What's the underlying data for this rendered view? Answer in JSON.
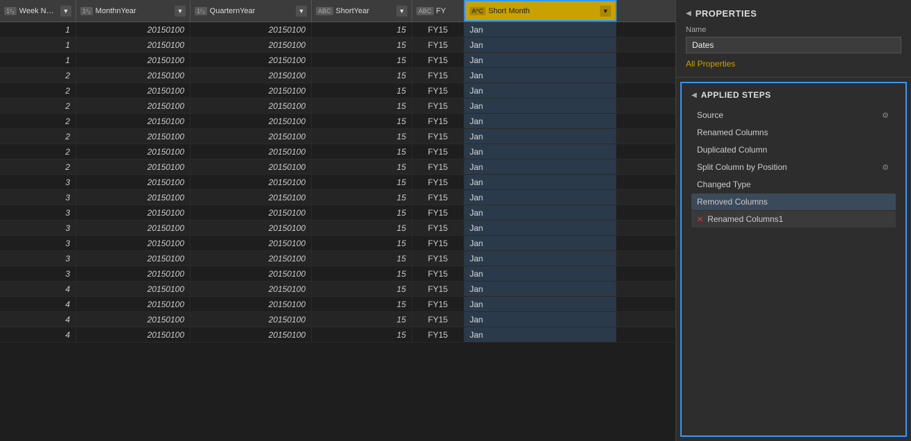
{
  "columns": [
    {
      "id": "week-number",
      "label": "Week Number",
      "type": "123",
      "typeLabel": "123"
    },
    {
      "id": "month-year",
      "label": "MonthnYear",
      "type": "123",
      "typeLabel": "1²₃"
    },
    {
      "id": "quarter-year",
      "label": "QuarternYear",
      "type": "123",
      "typeLabel": "1²₃"
    },
    {
      "id": "short-year",
      "label": "ShortYear",
      "type": "ABC",
      "typeLabel": "ABC"
    },
    {
      "id": "fy",
      "label": "FY",
      "type": "ABC",
      "typeLabel": "ABC"
    },
    {
      "id": "short-month",
      "label": "Short Month",
      "type": "ABC",
      "typeLabel": "A^C"
    }
  ],
  "rows": [
    {
      "weekNum": 1,
      "monthYear": "20150100",
      "quarterYear": "20150100",
      "shortYear": "15",
      "fy": "FY15",
      "shortMonth": "Jan"
    },
    {
      "weekNum": 1,
      "monthYear": "20150100",
      "quarterYear": "20150100",
      "shortYear": "15",
      "fy": "FY15",
      "shortMonth": "Jan"
    },
    {
      "weekNum": 1,
      "monthYear": "20150100",
      "quarterYear": "20150100",
      "shortYear": "15",
      "fy": "FY15",
      "shortMonth": "Jan"
    },
    {
      "weekNum": 2,
      "monthYear": "20150100",
      "quarterYear": "20150100",
      "shortYear": "15",
      "fy": "FY15",
      "shortMonth": "Jan"
    },
    {
      "weekNum": 2,
      "monthYear": "20150100",
      "quarterYear": "20150100",
      "shortYear": "15",
      "fy": "FY15",
      "shortMonth": "Jan"
    },
    {
      "weekNum": 2,
      "monthYear": "20150100",
      "quarterYear": "20150100",
      "shortYear": "15",
      "fy": "FY15",
      "shortMonth": "Jan"
    },
    {
      "weekNum": 2,
      "monthYear": "20150100",
      "quarterYear": "20150100",
      "shortYear": "15",
      "fy": "FY15",
      "shortMonth": "Jan"
    },
    {
      "weekNum": 2,
      "monthYear": "20150100",
      "quarterYear": "20150100",
      "shortYear": "15",
      "fy": "FY15",
      "shortMonth": "Jan"
    },
    {
      "weekNum": 2,
      "monthYear": "20150100",
      "quarterYear": "20150100",
      "shortYear": "15",
      "fy": "FY15",
      "shortMonth": "Jan"
    },
    {
      "weekNum": 2,
      "monthYear": "20150100",
      "quarterYear": "20150100",
      "shortYear": "15",
      "fy": "FY15",
      "shortMonth": "Jan"
    },
    {
      "weekNum": 3,
      "monthYear": "20150100",
      "quarterYear": "20150100",
      "shortYear": "15",
      "fy": "FY15",
      "shortMonth": "Jan"
    },
    {
      "weekNum": 3,
      "monthYear": "20150100",
      "quarterYear": "20150100",
      "shortYear": "15",
      "fy": "FY15",
      "shortMonth": "Jan"
    },
    {
      "weekNum": 3,
      "monthYear": "20150100",
      "quarterYear": "20150100",
      "shortYear": "15",
      "fy": "FY15",
      "shortMonth": "Jan"
    },
    {
      "weekNum": 3,
      "monthYear": "20150100",
      "quarterYear": "20150100",
      "shortYear": "15",
      "fy": "FY15",
      "shortMonth": "Jan"
    },
    {
      "weekNum": 3,
      "monthYear": "20150100",
      "quarterYear": "20150100",
      "shortYear": "15",
      "fy": "FY15",
      "shortMonth": "Jan"
    },
    {
      "weekNum": 3,
      "monthYear": "20150100",
      "quarterYear": "20150100",
      "shortYear": "15",
      "fy": "FY15",
      "shortMonth": "Jan"
    },
    {
      "weekNum": 3,
      "monthYear": "20150100",
      "quarterYear": "20150100",
      "shortYear": "15",
      "fy": "FY15",
      "shortMonth": "Jan"
    },
    {
      "weekNum": 4,
      "monthYear": "20150100",
      "quarterYear": "20150100",
      "shortYear": "15",
      "fy": "FY15",
      "shortMonth": "Jan"
    },
    {
      "weekNum": 4,
      "monthYear": "20150100",
      "quarterYear": "20150100",
      "shortYear": "15",
      "fy": "FY15",
      "shortMonth": "Jan"
    },
    {
      "weekNum": 4,
      "monthYear": "20150100",
      "quarterYear": "20150100",
      "shortYear": "15",
      "fy": "FY15",
      "shortMonth": "Jan"
    },
    {
      "weekNum": 4,
      "monthYear": "20150100",
      "quarterYear": "20150100",
      "shortYear": "15",
      "fy": "FY15",
      "shortMonth": "Jan"
    }
  ],
  "properties": {
    "sectionTitle": "PROPERTIES",
    "nameLabel": "Name",
    "nameValue": "Dates",
    "allPropertiesLink": "All Properties"
  },
  "appliedSteps": {
    "sectionTitle": "APPLIED STEPS",
    "steps": [
      {
        "id": "source",
        "label": "Source",
        "hasGear": true,
        "isSelected": false,
        "hasError": false
      },
      {
        "id": "renamed-columns",
        "label": "Renamed Columns",
        "hasGear": false,
        "isSelected": false,
        "hasError": false
      },
      {
        "id": "duplicated-column",
        "label": "Duplicated Column",
        "hasGear": false,
        "isSelected": false,
        "hasError": false
      },
      {
        "id": "split-column-by-position",
        "label": "Split Column by Position",
        "hasGear": true,
        "isSelected": false,
        "hasError": false
      },
      {
        "id": "changed-type",
        "label": "Changed Type",
        "hasGear": false,
        "isSelected": false,
        "hasError": false
      },
      {
        "id": "removed-columns",
        "label": "Removed Columns",
        "hasGear": false,
        "isSelected": true,
        "hasError": false
      },
      {
        "id": "renamed-columns1",
        "label": "Renamed Columns1",
        "hasGear": false,
        "isSelected": false,
        "hasError": true
      }
    ]
  }
}
